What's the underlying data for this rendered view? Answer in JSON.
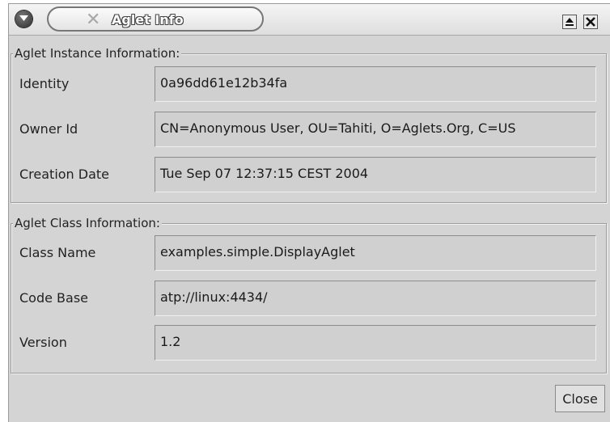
{
  "window": {
    "title": "Aglet Info"
  },
  "instance": {
    "legend": "Aglet Instance Information:",
    "rows": [
      {
        "label": "Identity",
        "value": "0a96dd61e12b34fa"
      },
      {
        "label": "Owner Id",
        "value": "CN=Anonymous User, OU=Tahiti, O=Aglets.Org, C=US"
      },
      {
        "label": "Creation Date",
        "value": "Tue Sep 07 12:37:15 CEST 2004"
      }
    ]
  },
  "classinfo": {
    "legend": "Aglet Class Information:",
    "rows": [
      {
        "label": "Class Name",
        "value": "examples.simple.DisplayAglet"
      },
      {
        "label": "Code Base",
        "value": "atp://linux:4434/"
      },
      {
        "label": "Version",
        "value": "1.2"
      }
    ]
  },
  "footer": {
    "close_label": "Close"
  },
  "icons": [
    "window-menu-icon",
    "close-x-icon",
    "shade-icon",
    "window-close-icon"
  ]
}
